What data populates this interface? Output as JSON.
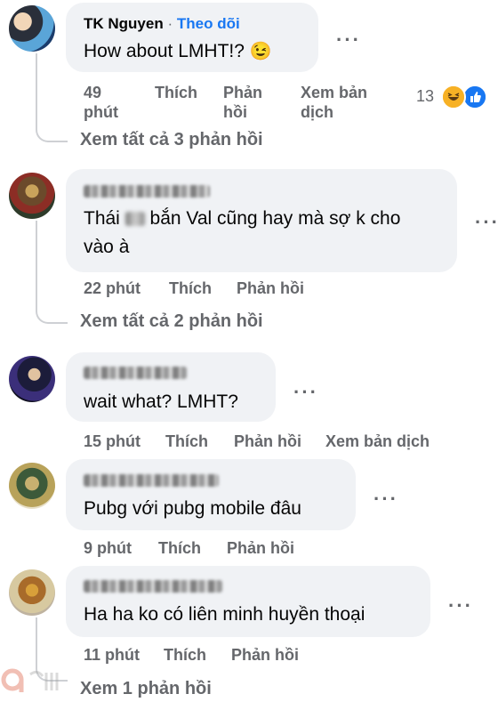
{
  "comments": [
    {
      "author": "TK Nguyen",
      "separator": "·",
      "follow": "Theo dõi",
      "text": "How about LMHT!?",
      "emoji": "😉",
      "time": "49 phút",
      "like": "Thích",
      "reply": "Phản hồi",
      "translate": "Xem bản dịch",
      "reaction_count": "13",
      "view_replies": "Xem tất cả 3 phản hồi"
    },
    {
      "text_part1": "Thái",
      "text_part2": "bắn Val cũng hay mà sợ k cho vào à",
      "time": "22 phút",
      "like": "Thích",
      "reply": "Phản hồi",
      "view_replies": "Xem tất cả 2 phản hồi"
    },
    {
      "text": "wait what? LMHT?",
      "time": "15 phút",
      "like": "Thích",
      "reply": "Phản hồi",
      "translate": "Xem bản dịch"
    },
    {
      "text": "Pubg với pubg mobile đâu",
      "time": "9 phút",
      "like": "Thích",
      "reply": "Phản hồi"
    },
    {
      "text": "Ha ha ko có liên minh huyền thoại",
      "time": "11 phút",
      "like": "Thích",
      "reply": "Phản hồi",
      "view_replies": "Xem 1 phản hồi"
    }
  ],
  "more_label": "···",
  "colors": {
    "follow": "#1877f2",
    "meta": "#65676b",
    "bubble": "#f0f2f5"
  }
}
